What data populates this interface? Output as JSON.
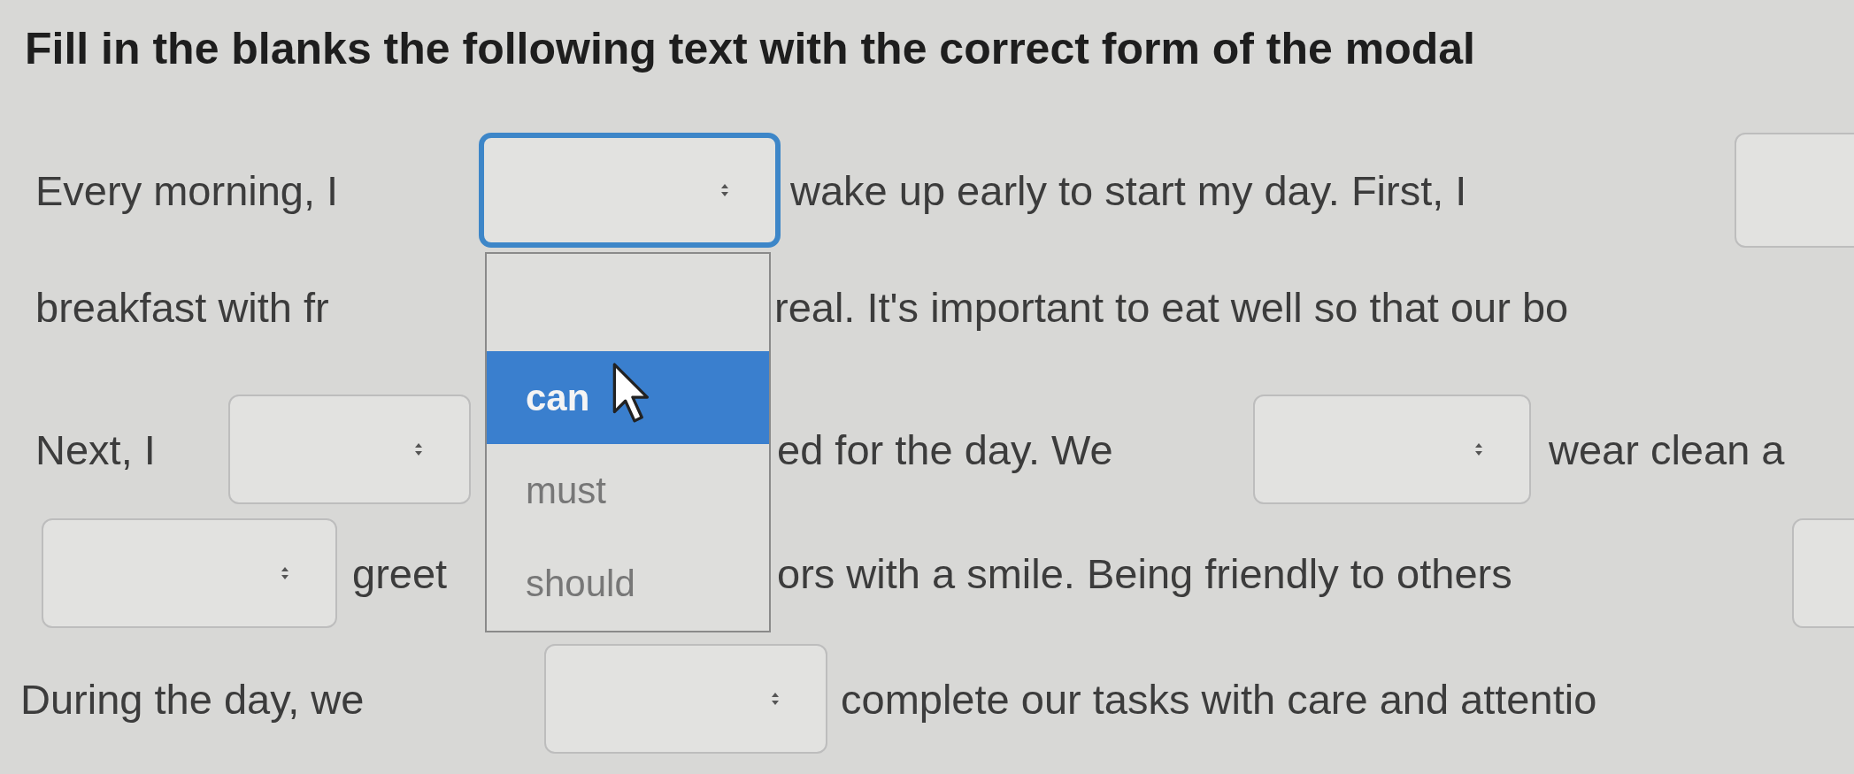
{
  "instruction": "Fill in the blanks the following text with the correct form of the modal",
  "lines": [
    {
      "segments": [
        {
          "kind": "text",
          "text": "Every morning, I"
        },
        {
          "kind": "select",
          "focused": true
        },
        {
          "kind": "text",
          "text": "wake up early to start my day. First, I"
        },
        {
          "kind": "select",
          "focused": false
        }
      ]
    },
    {
      "segments": [
        {
          "kind": "text",
          "text": "breakfast with fr"
        },
        {
          "kind": "text",
          "text": "real. It's important to eat well so that our bo"
        }
      ]
    },
    {
      "segments": [
        {
          "kind": "text",
          "text": "Next, I"
        },
        {
          "kind": "select",
          "focused": false
        },
        {
          "kind": "text",
          "text": "ed for the day. We"
        },
        {
          "kind": "select",
          "focused": false
        },
        {
          "kind": "text",
          "text": "wear clean a"
        }
      ]
    },
    {
      "segments": [
        {
          "kind": "select",
          "focused": false
        },
        {
          "kind": "text",
          "text": "greet"
        },
        {
          "kind": "text",
          "text": "ors with a smile. Being friendly to others"
        },
        {
          "kind": "select",
          "focused": false
        }
      ]
    },
    {
      "segments": [
        {
          "kind": "text",
          "text": "During the day, we"
        },
        {
          "kind": "select",
          "focused": false
        },
        {
          "kind": "text",
          "text": "complete our tasks with care and attentio"
        }
      ]
    }
  ],
  "dropdown": {
    "options": [
      {
        "label": "can",
        "selected": true
      },
      {
        "label": "must",
        "selected": false
      },
      {
        "label": "should",
        "selected": false
      }
    ]
  }
}
